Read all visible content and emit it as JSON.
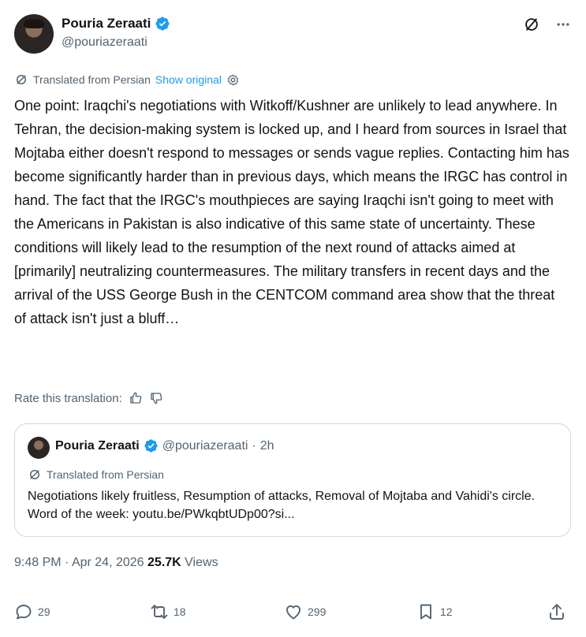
{
  "author": {
    "name": "Pouria Zeraati",
    "handle": "@pouriazeraati"
  },
  "translation_notice": {
    "text": "Translated from Persian",
    "link": "Show original"
  },
  "post_text": "One point: Iraqchi's negotiations with Witkoff/Kushner are unlikely to lead anywhere. In Tehran, the decision-making system is locked up, and I heard from sources in Israel that Mojtaba either doesn't respond to messages or sends vague replies. Contacting him has become significantly harder than in previous days, which means the IRGC has control in hand. The fact that the IRGC's mouthpieces are saying Iraqchi isn't going to meet with the Americans in Pakistan is also indicative of this same state of uncertainty. These conditions will likely lead to the resumption of the next round of attacks aimed at [primarily] neutralizing countermeasures. The military transfers in recent days and the arrival of the USS George Bush in the CENTCOM command area show that the threat of attack isn't just a bluff…",
  "rate_label": "Rate this translation:",
  "quote": {
    "name": "Pouria Zeraati",
    "handle": "@pouriazeraati",
    "separator": "·",
    "time": "2h",
    "translated": "Translated from Persian",
    "text": "Negotiations likely fruitless,  Resumption of attacks,  Removal of Mojtaba and Vahidi's circle. Word of the week: youtu.be/PWkqbtUDp00?si..."
  },
  "meta": {
    "time": "9:48 PM",
    "dot": "·",
    "date": "Apr 24, 2026",
    "views_count": "25.7K",
    "views_label": "Views"
  },
  "actions": {
    "replies": "29",
    "reposts": "18",
    "likes": "299",
    "bookmarks": "12"
  },
  "colors": {
    "accent": "#1d9bf0",
    "muted": "#536471",
    "text": "#0f1419",
    "border": "#cfd9de"
  },
  "icons": [
    "verified-badge-icon",
    "grok-icon",
    "more-icon",
    "translate-icon",
    "settings-icon",
    "thumbs-up-icon",
    "thumbs-down-icon",
    "reply-icon",
    "repost-icon",
    "like-icon",
    "bookmark-icon",
    "share-icon"
  ]
}
